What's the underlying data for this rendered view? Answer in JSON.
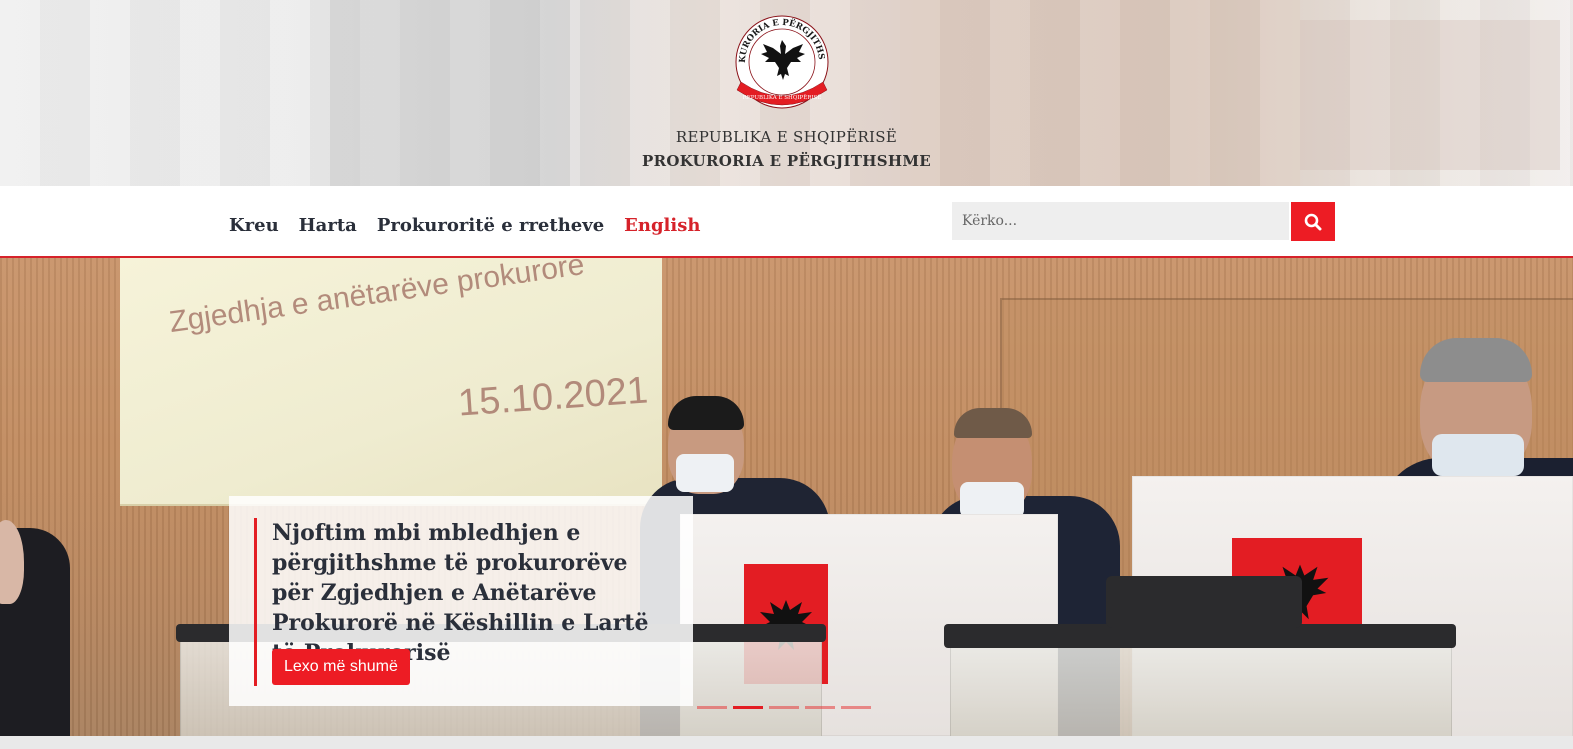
{
  "header": {
    "seal_text_top": "PROKURORIA E PËRGJITHSHME",
    "seal_text_bottom": "REPUBLIKA E SHQIPËRISË",
    "republic": "REPUBLIKA E SHQIPËRISË",
    "institution": "PROKURORIA E PËRGJITHSHME"
  },
  "nav": {
    "items": [
      {
        "label": "Kreu"
      },
      {
        "label": "Harta"
      },
      {
        "label": "Prokuroritë e rretheve"
      },
      {
        "label": "English"
      }
    ]
  },
  "search": {
    "placeholder": "Kërko...",
    "icon": "search-icon"
  },
  "hero": {
    "screen_title": "Zgjedhja e anëtarëve prokurorë",
    "screen_date": "15.10.2021",
    "caption_title": "Njoftim mbi mbledhjen e përgjithshme të prokurorëve për Zgjedhjen e Anëtarëve Prokurorë në Këshillin e Lartë të Prokurorisë",
    "read_more": "Lexo më shumë",
    "slides_count": 5,
    "active_slide": 2
  },
  "colors": {
    "accent": "#ed1c24",
    "nav_text": "#2a2f3a"
  }
}
